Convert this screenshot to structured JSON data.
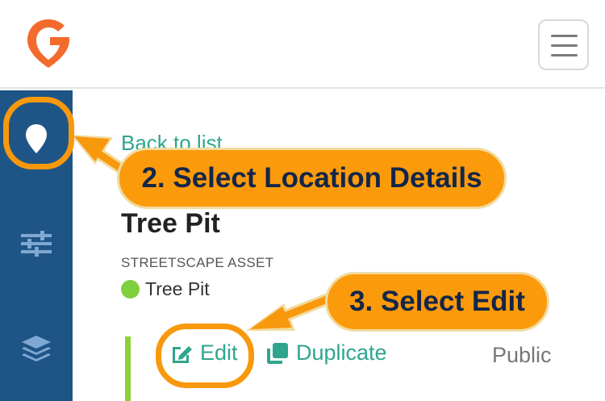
{
  "header": {
    "logo_icon": "gsmart-logo-icon",
    "menu_icon": "hamburger-menu-icon",
    "brand_color": "#f26b2c"
  },
  "sidebar": {
    "background": "#1f5586",
    "items": [
      {
        "icon": "map-pin-icon",
        "active": true
      },
      {
        "icon": "sliders-icon",
        "active": false
      },
      {
        "icon": "layers-icon",
        "active": false
      }
    ]
  },
  "detail": {
    "back_label": "Back to list",
    "title": "Tree Pit",
    "category": "STREETSCAPE ASSET",
    "type_label": "Tree Pit",
    "type_color": "#7ed03d",
    "actions": {
      "edit_label": "Edit",
      "duplicate_label": "Duplicate",
      "visibility_label": "Public"
    }
  },
  "annotations": {
    "step2": "2. Select Location Details",
    "step3": "3. Select Edit",
    "highlight_color": "#f8980d"
  }
}
